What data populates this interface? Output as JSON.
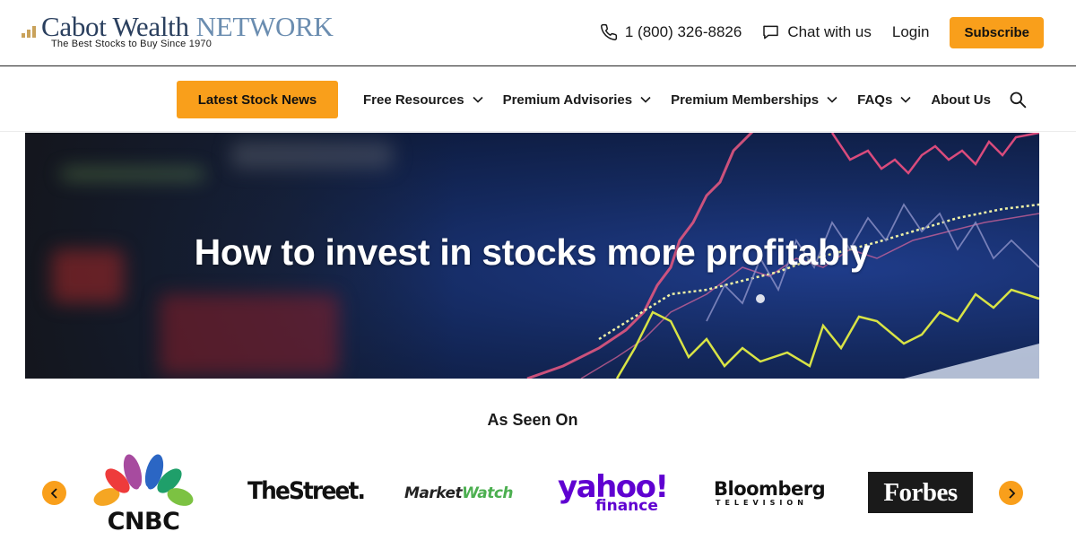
{
  "header": {
    "logo": {
      "brand_main": "Cabot Wealth",
      "brand_network": "NETWORK",
      "tagline": "The Best Stocks to Buy Since 1970"
    },
    "phone": "1 (800) 326-8826",
    "chat_label": "Chat with us",
    "login_label": "Login",
    "subscribe_label": "Subscribe"
  },
  "nav": {
    "cta_label": "Latest Stock News",
    "items": [
      {
        "label": "Free Resources",
        "has_dropdown": true
      },
      {
        "label": "Premium Advisories",
        "has_dropdown": true
      },
      {
        "label": "Premium Memberships",
        "has_dropdown": true
      },
      {
        "label": "FAQs",
        "has_dropdown": true
      },
      {
        "label": "About Us",
        "has_dropdown": false
      }
    ],
    "search_icon": "search-icon"
  },
  "hero": {
    "title": "How to invest in stocks more profitably"
  },
  "as_seen_on": {
    "title": "As Seen On",
    "logos": {
      "cnbc": "CNBC",
      "thestreet": "TheStreet.",
      "marketwatch_a": "Market",
      "marketwatch_b": "Watch",
      "yahoo_main": "yahoo!",
      "yahoo_sub": "finance",
      "bloomberg_main": "Bloomberg",
      "bloomberg_sub": "TELEVISION",
      "forbes": "Forbes"
    },
    "prev_icon": "chevron-left-icon",
    "next_icon": "chevron-right-icon"
  },
  "colors": {
    "accent": "#f99f1b",
    "brand_navy": "#2a3f5e",
    "brand_light": "#6b8db0",
    "yahoo_purple": "#5f01d1",
    "marketwatch_green": "#4caf50"
  }
}
